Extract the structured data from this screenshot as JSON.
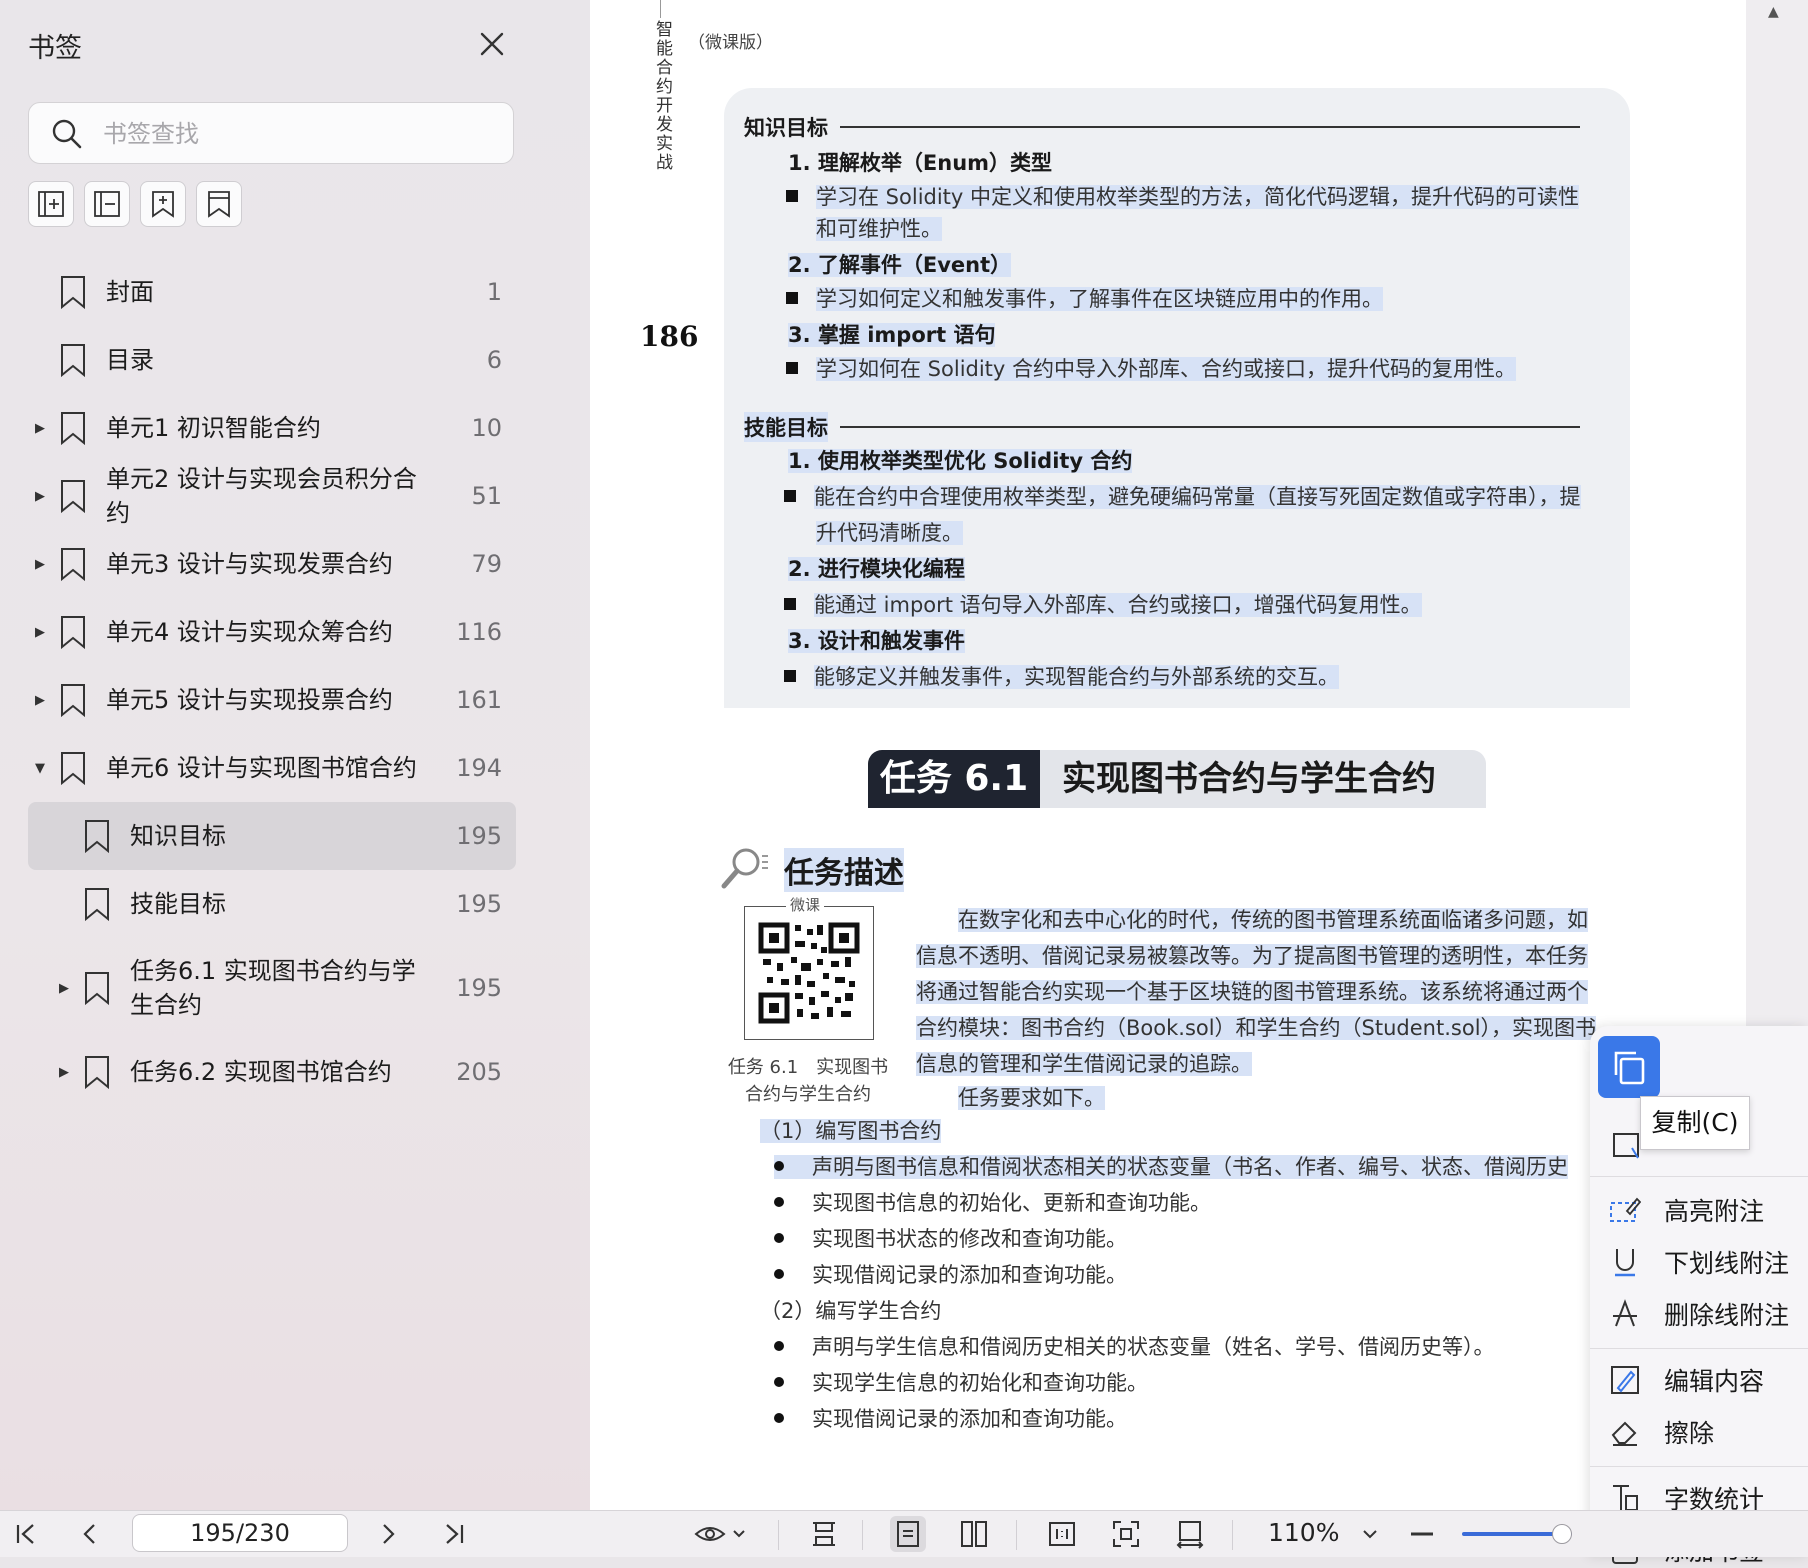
{
  "sidebar": {
    "title": "书签",
    "search_placeholder": "书签查找",
    "items": [
      {
        "label": "封面",
        "page": "1"
      },
      {
        "label": "目录",
        "page": "6"
      },
      {
        "label": "单元1 初识智能合约",
        "page": "10"
      },
      {
        "label": "单元2 设计与实现会员积分合约",
        "page": "51"
      },
      {
        "label": "单元3 设计与实现发票合约",
        "page": "79"
      },
      {
        "label": "单元4 设计与实现众筹合约",
        "page": "116"
      },
      {
        "label": "单元5 设计与实现投票合约",
        "page": "161"
      },
      {
        "label": "单元6 设计与实现图书馆合约",
        "page": "194"
      },
      {
        "label": "知识目标",
        "page": "195"
      },
      {
        "label": "技能目标",
        "page": "195"
      },
      {
        "label": "任务6.1 实现图书合约与学生合约",
        "page": "195"
      },
      {
        "label": "任务6.2 实现图书馆合约",
        "page": "205"
      }
    ]
  },
  "bottombar": {
    "page_indicator": "195/230",
    "zoom": "110%"
  },
  "document": {
    "running_head": "智能合约开发实战",
    "running_head_sub": "（微课版）",
    "page_number": "186",
    "knowledge_heading": "知识目标",
    "knowledge": [
      {
        "title": "1.  理解枚举（Enum）类型",
        "lines": [
          "学习在 Solidity 中定义和使用枚举类型的方法，简化代码逻辑，提升代码的可读性",
          "和可维护性。"
        ]
      },
      {
        "title": "2.  了解事件（Event）",
        "lines": [
          "学习如何定义和触发事件，了解事件在区块链应用中的作用。"
        ]
      },
      {
        "title": "3.  掌握 import 语句",
        "lines": [
          "学习如何在 Solidity 合约中导入外部库、合约或接口，提升代码的复用性。"
        ]
      }
    ],
    "skill_heading": "技能目标",
    "skills": [
      {
        "title": "1.  使用枚举类型优化 Solidity 合约",
        "lines": [
          "能在合约中合理使用枚举类型，避免硬编码常量（直接写死固定数值或字符串），提",
          "升代码清晰度。"
        ]
      },
      {
        "title": "2.  进行模块化编程",
        "lines": [
          "能通过 import 语句导入外部库、合约或接口，增强代码复用性。"
        ]
      },
      {
        "title": "3.  设计和触发事件",
        "lines": [
          "能够定义并触发事件，实现智能合约与外部系统的交互。"
        ]
      }
    ],
    "task_number": "任务 6.1",
    "task_title": "实现图书合约与学生合约",
    "desc_title": "任务描述",
    "qr_label": "微课",
    "qr_caption_1": "任务 6.1　实现图书",
    "qr_caption_2": "合约与学生合约",
    "desc_lines": [
      "在数字化和去中心化的时代，传统的图书管理系统面临诸多问题，如",
      "信息不透明、借阅记录易被篡改等。为了提高图书管理的透明性，本任务",
      "将通过智能合约实现一个基于区块链的图书管理系统。该系统将通过两个",
      "合约模块：图书合约（Book.sol）和学生合约（Student.sol），实现图书",
      "信息的管理和学生借阅记录的追踪。"
    ],
    "req_intro": "任务要求如下。",
    "book_heading": "（1）编写图书合约",
    "book_items": [
      "声明与图书信息和借阅状态相关的状态变量（书名、作者、编号、状态、借阅历史",
      "实现图书信息的初始化、更新和查询功能。",
      "实现图书状态的修改和查询功能。",
      "实现借阅记录的添加和查询功能。"
    ],
    "student_heading": "（2）编写学生合约",
    "student_items": [
      "声明与学生信息和借阅历史相关的状态变量（姓名、学号、借阅历史等）。",
      "实现学生信息的初始化和查询功能。",
      "实现借阅记录的添加和查询功能。"
    ]
  },
  "context_menu": {
    "copy_tooltip": "复制(C)",
    "items": [
      "高亮附注",
      "下划线附注",
      "删除线附注",
      "编辑内容",
      "擦除",
      "字数统计",
      "添加书签"
    ]
  }
}
